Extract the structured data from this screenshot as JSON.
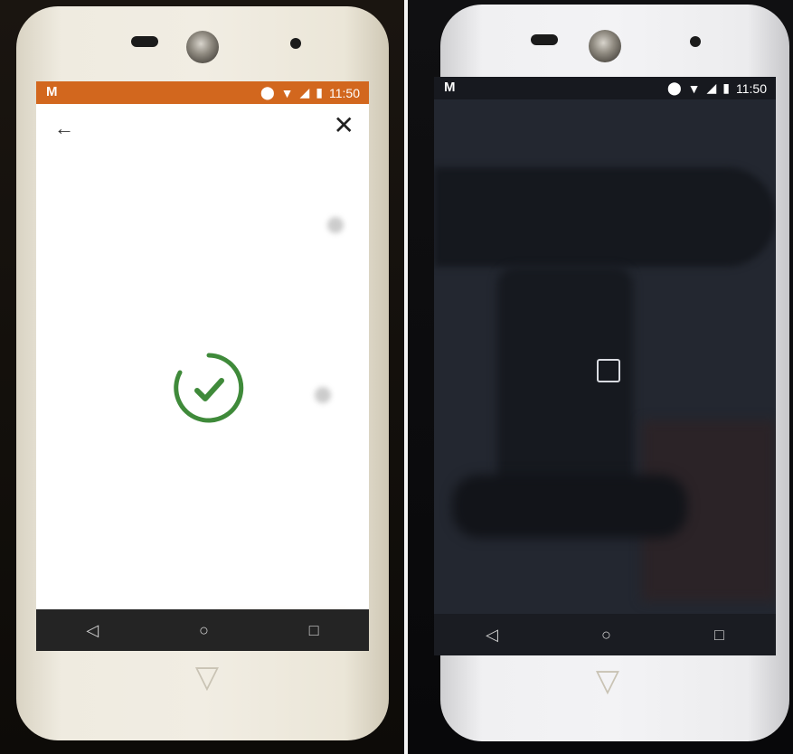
{
  "left_device": {
    "status_bar": {
      "app_icon": "M",
      "time": "11:50",
      "icons": [
        "location-icon",
        "wifi-icon",
        "signal-icon",
        "battery-icon"
      ]
    },
    "app_bar": {
      "back_icon": "←",
      "close_icon": "✕"
    },
    "overlay": {
      "state": "success",
      "icon": "check-circle-icon",
      "color": "#3f8a3a"
    },
    "blurred_content": {
      "title": "",
      "rows": [
        "",
        "",
        "",
        ""
      ],
      "buttons": [
        "",
        ""
      ]
    },
    "nav_bar": {
      "back": "◁",
      "home": "○",
      "recents": "□"
    },
    "colors": {
      "status_bar": "#d2671e",
      "accent": "#efc08f"
    }
  },
  "right_device": {
    "status_bar": {
      "app_icon": "M",
      "time": "11:50",
      "icons": [
        "location-icon",
        "wifi-icon",
        "signal-icon",
        "battery-icon"
      ]
    },
    "camera_view": {
      "viewfinder_icon": "square-outline-icon"
    },
    "nav_bar": {
      "back": "◁",
      "home": "○",
      "recents": "□"
    }
  }
}
